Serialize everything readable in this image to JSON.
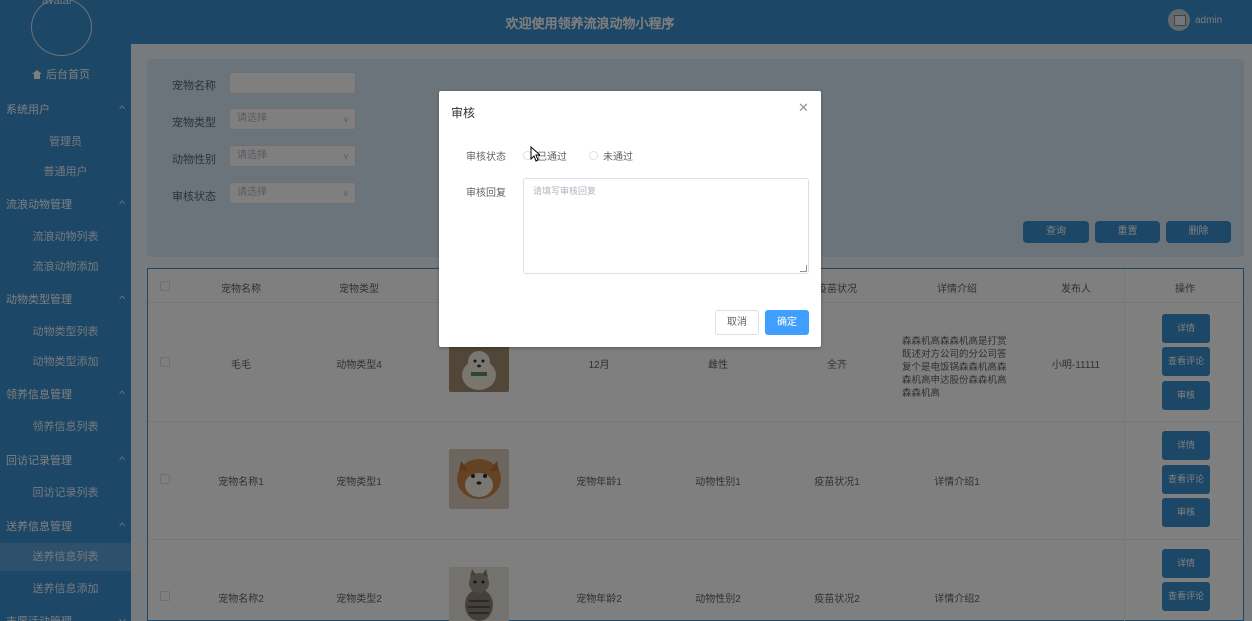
{
  "app": {
    "title": "欢迎使用领养流浪动物小程序",
    "avatar_text": "avatar",
    "username": "admin"
  },
  "sidebar": {
    "home": "后台首页",
    "groups": [
      {
        "label": "系统用户",
        "items": [
          "管理员",
          "普通用户"
        ]
      },
      {
        "label": "流浪动物管理",
        "items": [
          "流浪动物列表",
          "流浪动物添加"
        ]
      },
      {
        "label": "动物类型管理",
        "items": [
          "动物类型列表",
          "动物类型添加"
        ]
      },
      {
        "label": "领养信息管理",
        "items": [
          "领养信息列表"
        ]
      },
      {
        "label": "回访记录管理",
        "items": [
          "回访记录列表"
        ]
      },
      {
        "label": "送养信息管理",
        "items": [
          "送养信息列表",
          "送养信息添加"
        ]
      },
      {
        "label": "志愿活动管理",
        "items": []
      }
    ],
    "active_item": "送养信息列表"
  },
  "search": {
    "fields": [
      {
        "label": "宠物名称",
        "value": ""
      },
      {
        "label": "宠物类型",
        "placeholder": "请选择"
      },
      {
        "label": "动物性别",
        "placeholder": "请选择"
      },
      {
        "label": "审核状态",
        "placeholder": "请选择"
      }
    ],
    "buttons": {
      "query": "查询",
      "reset": "重置",
      "delete": "删除"
    }
  },
  "table": {
    "columns": [
      "宠物名称",
      "宠物类型",
      "",
      "",
      "",
      "疫苗状况",
      "详情介绍",
      "发布人",
      "操作"
    ],
    "rows": [
      {
        "name": "毛毛",
        "type": "动物类型4",
        "age": "12月",
        "gender": "雌性",
        "vaccine": "全齐",
        "intro": "森森机高森森机高是打赏既述对方公司的分公司答复个是电饭锅森森机高森森机高申达股份森森机高森森机高",
        "publisher": "小明-11111"
      },
      {
        "name": "宠物名称1",
        "type": "宠物类型1",
        "age": "宠物年龄1",
        "gender": "动物性别1",
        "vaccine": "疫苗状况1",
        "intro": "详情介绍1",
        "publisher": ""
      },
      {
        "name": "宠物名称2",
        "type": "宠物类型2",
        "age": "宠物年龄2",
        "gender": "动物性别2",
        "vaccine": "疫苗状况2",
        "intro": "详情介绍2",
        "publisher": ""
      }
    ],
    "ops": {
      "detail": "详情",
      "comments": "查看评论",
      "review": "审核"
    }
  },
  "dialog": {
    "title": "审核",
    "status_label": "审核状态",
    "options": [
      "已通过",
      "未通过"
    ],
    "reply_label": "审核回复",
    "reply_placeholder": "请填写审核回复",
    "cancel": "取消",
    "confirm": "确定"
  }
}
